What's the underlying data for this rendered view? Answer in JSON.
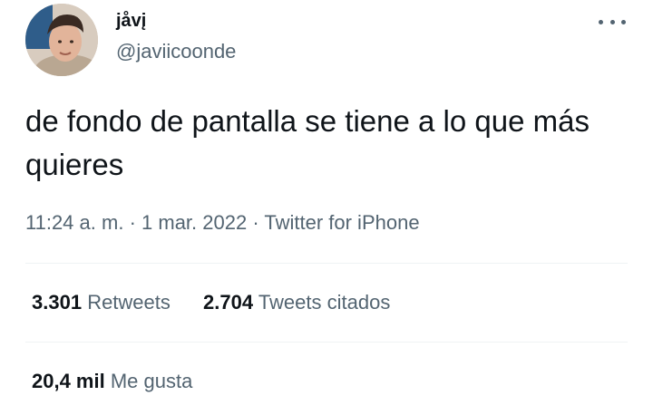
{
  "user": {
    "display_name": "jåvį",
    "handle": "@javiicoonde"
  },
  "tweet": {
    "text": "de fondo de pantalla se tiene a lo que más quieres",
    "time": "11:24 a. m.",
    "separator": "·",
    "date": "1 mar. 2022",
    "source": "Twitter for iPhone"
  },
  "stats": {
    "retweets_count": "3.301",
    "retweets_label": "Retweets",
    "quotes_count": "2.704",
    "quotes_label": "Tweets citados",
    "likes_count": "20,4 mil",
    "likes_label": "Me gusta"
  },
  "icons": {
    "more": "more-horizontal-icon"
  },
  "colors": {
    "text_primary": "#0f1419",
    "text_secondary": "#536471",
    "divider": "#eff3f4"
  }
}
